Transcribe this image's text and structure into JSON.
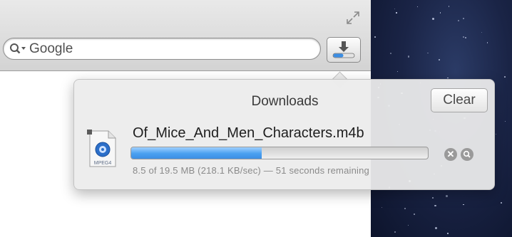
{
  "search": {
    "value": "Google",
    "icon": "search-icon"
  },
  "toolbar": {
    "fullscreen_icon": "fullscreen-icon",
    "downloads_icon": "download-icon"
  },
  "downloads": {
    "title": "Downloads",
    "clear_label": "Clear",
    "items": [
      {
        "file_name": "Of_Mice_And_Men_Characters.m4b",
        "file_type_label": "MPEG4",
        "progress": 0.44,
        "status": "8.5 of 19.5 MB (218.1 KB/sec) — 51 seconds remaining"
      }
    ]
  },
  "colors": {
    "progress_fill": "#4aa0f0",
    "desktop_background": "#1a2446"
  }
}
